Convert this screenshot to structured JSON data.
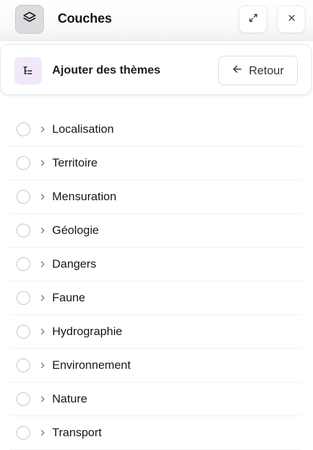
{
  "header": {
    "title": "Couches",
    "icons": {
      "layers": "layers-icon",
      "expand": "expand-icon",
      "close": "close-icon"
    }
  },
  "theme_panel": {
    "title": "Ajouter des thèmes",
    "icon": "tree-list-icon",
    "icon_bg": "#f1e8fb",
    "back_label": "Retour"
  },
  "themes": [
    {
      "label": "Localisation"
    },
    {
      "label": "Territoire"
    },
    {
      "label": "Mensuration"
    },
    {
      "label": "Géologie"
    },
    {
      "label": "Dangers"
    },
    {
      "label": "Faune"
    },
    {
      "label": "Hydrographie"
    },
    {
      "label": "Environnement"
    },
    {
      "label": "Nature"
    },
    {
      "label": "Transport"
    }
  ]
}
